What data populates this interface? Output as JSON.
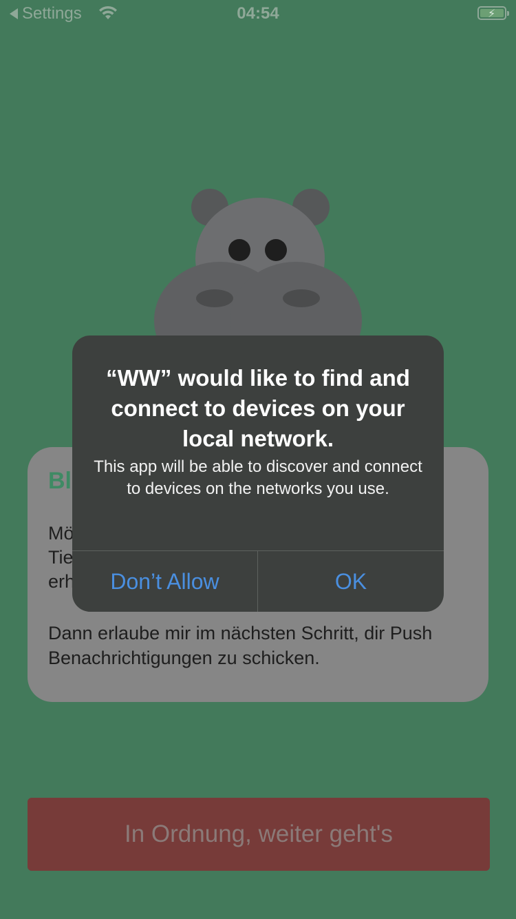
{
  "status_bar": {
    "back_label": "Settings",
    "time": "04:54",
    "icons": [
      "back-arrow-icon",
      "wifi-icon",
      "battery-charging-icon"
    ]
  },
  "card": {
    "title_visible": "Bl",
    "line1_visible": "Mö",
    "line2_visible": "Tie",
    "line3_visible": "erh",
    "paragraph2": "Dann erlaube mir im nächsten Schritt, dir Push Benachrichtigungen zu schicken."
  },
  "continue_button": {
    "label": "In Ordnung, weiter geht's"
  },
  "alert": {
    "title": "“WW” would like to find and connect to devices on your local network.",
    "message": "This app will be able to discover and connect to devices on the networks you use.",
    "deny_label": "Don’t Allow",
    "ok_label": "OK"
  },
  "colors": {
    "background": "#437a5b",
    "alert_bg": "#3d403e",
    "alert_button": "#4a8fe0",
    "continue_button_bg": "#773b39",
    "card_bg": "#868686",
    "card_title": "#3f8a64"
  }
}
